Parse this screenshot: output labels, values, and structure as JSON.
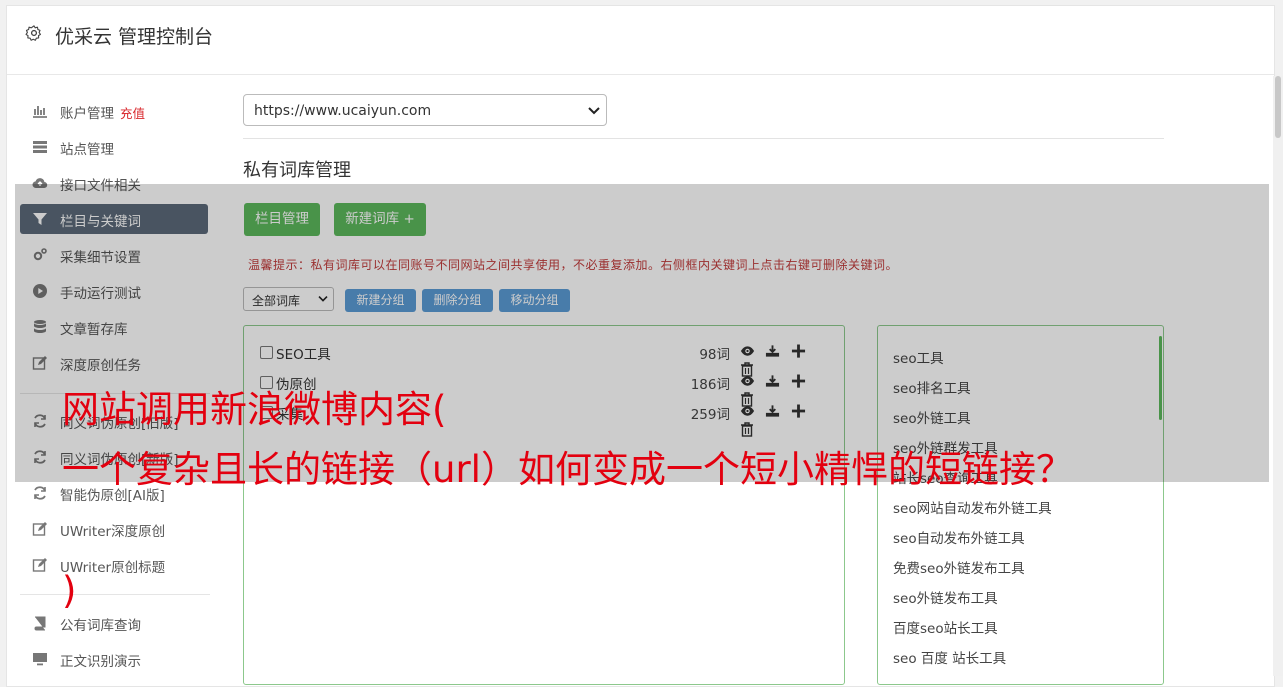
{
  "header": {
    "title": "优采云 管理控制台"
  },
  "sidebar": {
    "items": [
      {
        "label": "账户管理",
        "badge": "充值",
        "icon": "bar-chart-icon"
      },
      {
        "label": "站点管理",
        "icon": "server-icon"
      },
      {
        "label": "接口文件相关",
        "icon": "cloud-upload-icon"
      },
      {
        "label": "栏目与关键词",
        "icon": "filter-icon",
        "active": true
      },
      {
        "label": "采集细节设置",
        "icon": "gears-icon"
      },
      {
        "label": "手动运行测试",
        "icon": "play-circle-icon"
      },
      {
        "label": "文章暂存库",
        "icon": "database-icon"
      },
      {
        "label": "深度原创任务",
        "icon": "edit-icon"
      },
      {
        "label": "同义词伪原创[旧版]",
        "icon": "refresh-icon"
      },
      {
        "label": "同义词伪原创[新版]",
        "icon": "refresh-icon"
      },
      {
        "label": "智能伪原创[AI版]",
        "icon": "refresh-icon"
      },
      {
        "label": "UWriter深度原创",
        "icon": "edit-icon"
      },
      {
        "label": "UWriter原创标题",
        "icon": "edit-icon"
      },
      {
        "label": "公有词库查询",
        "icon": "book-icon"
      },
      {
        "label": "正文识别演示",
        "icon": "monitor-icon"
      }
    ]
  },
  "main": {
    "site_select": {
      "value": "https://www.ucaiyun.com"
    },
    "section_title": "私有词库管理",
    "buttons": {
      "column_manage": "栏目管理",
      "new_library": "新建词库 +"
    },
    "tip": "温馨提示：私有词库可以在同账号不同网站之间共享使用，不必重复添加。右侧框内关键词上点击右键可删除关键词。",
    "filter": {
      "select_value": "全部词库",
      "new_group": "新建分组",
      "delete_group": "删除分组",
      "move_group": "移动分组"
    },
    "libraries": [
      {
        "name": "SEO工具",
        "count": "98词"
      },
      {
        "name": "伪原创",
        "count": "186词"
      },
      {
        "name": "采集",
        "count": "259词"
      }
    ],
    "keywords": [
      "seo工具",
      "seo排名工具",
      "seo外链工具",
      "seo外链群发工具",
      "站长seo查询工具",
      "seo网站自动发布外链工具",
      "seo自动发布外链工具",
      "免费seo外链发布工具",
      "seo外链发布工具",
      "百度seo站长工具",
      "seo 百度 站长工具"
    ]
  },
  "overlay": {
    "line1": "网站调用新浪微博内容(",
    "line2": "一个复杂且长的链接（url）如何变成一个短小精悍的短链接？",
    "line3": ")"
  }
}
